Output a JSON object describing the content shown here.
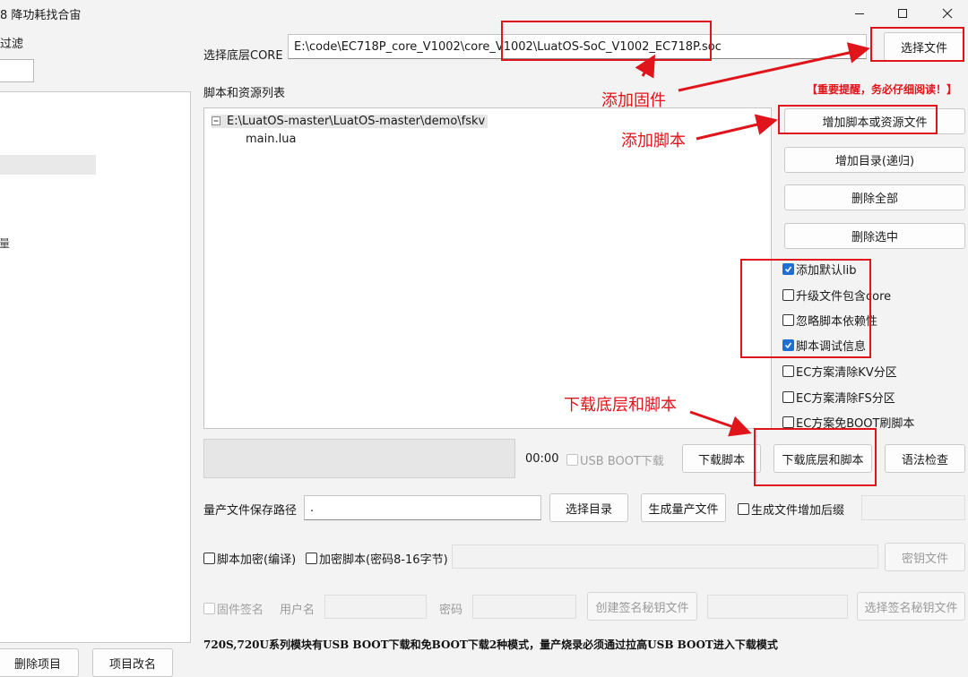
{
  "window": {
    "title": "8 降功耗找合宙",
    "controls": {
      "minimize": "minimize-icon",
      "maximize": "maximize-icon",
      "close": "close-icon"
    }
  },
  "left_panel": {
    "filter_label": "过滤",
    "list_item_text": "量",
    "delete_project": "删除项目",
    "rename_project": "项目改名"
  },
  "core": {
    "label": "选择底层CORE",
    "path": "E:\\code\\EC718P_core_V1002\\core_V1002\\LuatOS-SoC_V1002_EC718P.soc",
    "select_file": "选择文件"
  },
  "scripts": {
    "label": "脚本和资源列表",
    "tree": {
      "root": "E:\\LuatOS-master\\LuatOS-master\\demo\\fskv",
      "children": [
        "main.lua"
      ]
    },
    "warning": "【重要提醒，务必仔细阅读！】",
    "buttons": {
      "add_script": "增加脚本或资源文件",
      "add_dir": "增加目录(递归)",
      "delete_all": "删除全部",
      "delete_selected": "删除选中"
    },
    "options": [
      {
        "label": "添加默认lib",
        "checked": true
      },
      {
        "label": "升级文件包含core",
        "checked": false
      },
      {
        "label": "忽略脚本依赖性",
        "checked": false
      },
      {
        "label": "脚本调试信息",
        "checked": true
      },
      {
        "label": "EC方案清除KV分区",
        "checked": false
      },
      {
        "label": "EC方案清除FS分区",
        "checked": false
      },
      {
        "label": "EC方案免BOOT刷脚本",
        "checked": false
      }
    ]
  },
  "download": {
    "timer": "00:00",
    "usb_boot_label": "USB BOOT下载",
    "download_script": "下载脚本",
    "download_core_script": "下载底层和脚本",
    "syntax_check": "语法检查"
  },
  "mass_production": {
    "save_path_label": "量产文件保存路径",
    "save_path_value": ".",
    "select_dir": "选择目录",
    "generate": "生成量产文件",
    "add_suffix_label": "生成文件增加后缀"
  },
  "encryption": {
    "encrypt_compile_label": "脚本加密(编译)",
    "encrypt_password_label": "加密脚本(密码8-16字节)",
    "key_file": "密钥文件"
  },
  "signing": {
    "firmware_sign_label": "固件签名",
    "username_label": "用户名",
    "password_label": "密码",
    "create_key": "创建签名秘钥文件",
    "select_key": "选择签名秘钥文件"
  },
  "footer_note": "720S,720U系列模块有USB BOOT下载和免BOOT下载2种模式，量产烧录必须通过拉高USB BOOT进入下载模式",
  "annotations": {
    "add_firmware": "添加固件",
    "add_script": "添加脚本",
    "download_core_script": "下载底层和脚本",
    "color": "#e0141b"
  }
}
